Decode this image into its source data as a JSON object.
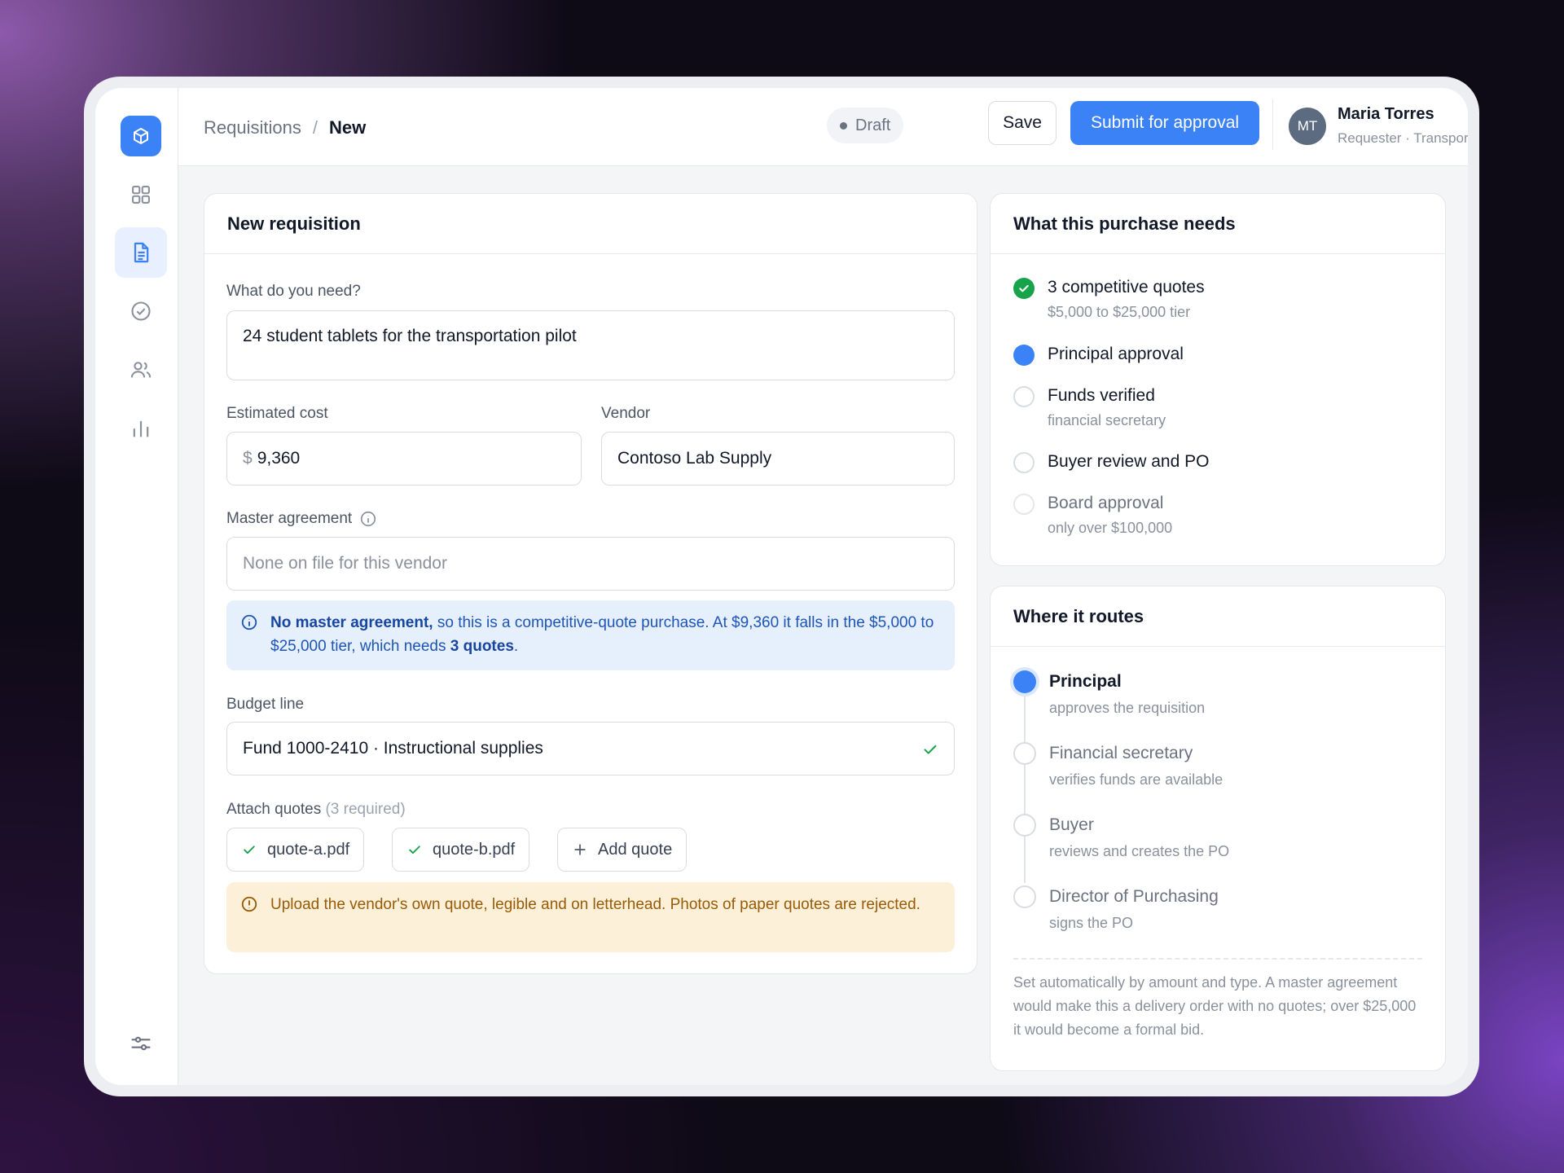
{
  "header": {
    "breadcrumb_parent": "Requisitions",
    "breadcrumb_sep": "/",
    "breadcrumb_current": "New",
    "status": "Draft",
    "save_label": "Save",
    "submit_label": "Submit for approval",
    "user": {
      "initials": "MT",
      "name": "Maria Torres",
      "role": "Requester · Transport office"
    }
  },
  "form": {
    "title": "New requisition",
    "need_label": "What do you need?",
    "need_value": "24 student tablets for the transportation pilot",
    "cost_label": "Estimated cost",
    "cost_currency": "$",
    "cost_value": "9,360",
    "vendor_label": "Vendor",
    "vendor_value": "Contoso Lab Supply",
    "master_label": "Master agreement",
    "master_placeholder": "None on file for this vendor",
    "info_alert": {
      "bold_lead": "No master agreement,",
      "text_1": " so this is a competitive-quote purchase. At $9,360 it falls in the $5,000 to $25,000 tier, which needs ",
      "bold_tail": "3 quotes",
      "text_2": "."
    },
    "budget_label": "Budget line",
    "budget_value": "Fund 1000-2410 · Instructional supplies",
    "attach_label": "Attach quotes",
    "attach_hint": "(3 required)",
    "attachments": [
      "quote-a.pdf",
      "quote-b.pdf"
    ],
    "add_quote_label": "Add quote",
    "warning": "Upload the vendor's own quote, legible and on letterhead. Photos of paper quotes are rejected."
  },
  "needs": {
    "title": "What this purchase needs",
    "items": [
      {
        "title": "3 competitive quotes",
        "sub": "$5,000 to $25,000 tier",
        "state": "done"
      },
      {
        "title": "Principal approval",
        "sub": "",
        "state": "current"
      },
      {
        "title": "Funds verified",
        "sub": "financial secretary",
        "state": "pending"
      },
      {
        "title": "Buyer review and PO",
        "sub": "",
        "state": "pending"
      },
      {
        "title": "Board approval",
        "sub": "only over $100,000",
        "state": "not-applicable"
      }
    ]
  },
  "routes": {
    "title": "Where it routes",
    "stops": [
      {
        "title": "Principal",
        "sub": "approves the requisition",
        "state": "active"
      },
      {
        "title": "Financial secretary",
        "sub": "verifies funds are available",
        "state": "pending"
      },
      {
        "title": "Buyer",
        "sub": "reviews and creates the PO",
        "state": "pending"
      },
      {
        "title": "Director of Purchasing",
        "sub": "signs the PO",
        "state": "pending"
      }
    ],
    "note": "Set automatically by amount and type. A master agreement would make this a delivery order with no quotes; over $25,000 it would become a formal bid."
  },
  "colors": {
    "accent": "#3b82f6",
    "success": "#16a34a",
    "info_bg": "#e6effc",
    "warn_bg": "#fcf0d9"
  }
}
